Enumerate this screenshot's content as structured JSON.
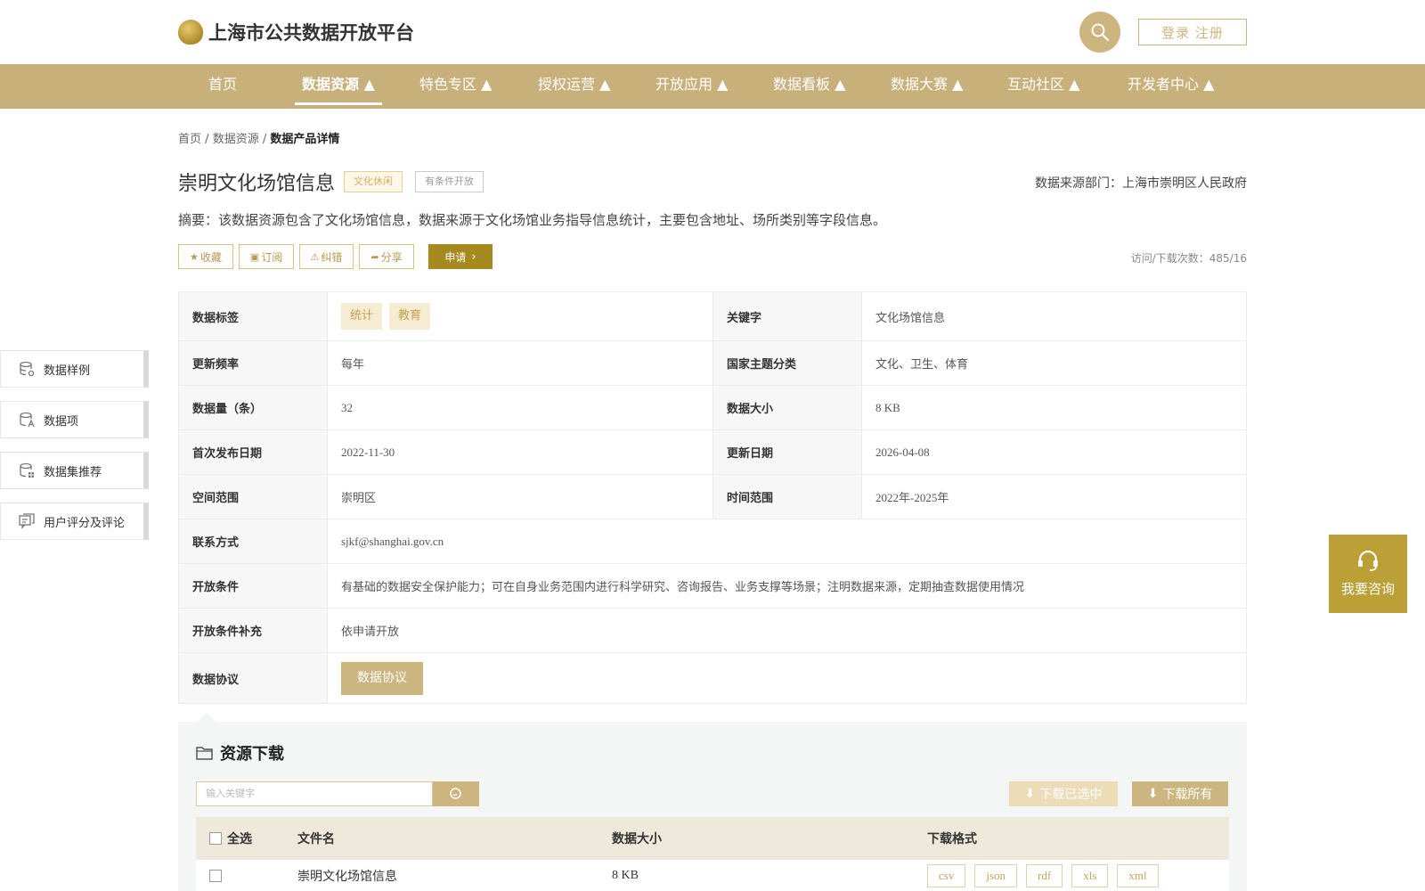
{
  "header": {
    "logo_text": "上海市公共数据开放平台",
    "login_label": "登录 注册",
    "nav": [
      {
        "label": "首页"
      },
      {
        "label": "数据资源 ▲"
      },
      {
        "label": "特色专区 ▲"
      },
      {
        "label": "授权运营 ▲"
      },
      {
        "label": "开放应用 ▲"
      },
      {
        "label": "数据看板 ▲"
      },
      {
        "label": "数据大赛 ▲"
      },
      {
        "label": "互动社区 ▲"
      },
      {
        "label": "开发者中心 ▲"
      }
    ],
    "active_nav": "数据资源 ▲"
  },
  "breadcrumb": {
    "home": "首页",
    "sep": "/",
    "level2": "数据资源",
    "current": "数据产品详情"
  },
  "dataset": {
    "title": "崇明文化场馆信息",
    "tag_category": "文化休闲",
    "tag_openness": "有条件开放",
    "source_dept": "数据来源部门：上海市崇明区人民政府",
    "summary": "摘要：该数据资源包含了文化场馆信息，数据来源于文化场馆业务指导信息统计，主要包含地址、场所类别等字段信息。",
    "visits": "访问/下载次数：485/16"
  },
  "actions": {
    "favorite": "收藏",
    "subscribe": "订阅",
    "correct": "纠错",
    "share": "分享",
    "apply": "申请"
  },
  "details": {
    "tags_label": "数据标签",
    "tags": [
      "统计",
      "教育"
    ],
    "keyword_label": "关键字",
    "keyword": "文化场馆信息",
    "freq_label": "更新频率",
    "freq": "每年",
    "theme_label": "国家主题分类",
    "theme": "文化、卫生、体育",
    "count_label": "数据量（条）",
    "count": "32",
    "size_label": "数据大小",
    "size": "8 KB",
    "first_pub_label": "首次发布日期",
    "first_pub": "2022-11-30",
    "update_label": "更新日期",
    "update": "2026-04-08",
    "space_label": "空间范围",
    "space": "崇明区",
    "time_label": "时间范围",
    "time": "2022年-2025年",
    "contact_label": "联系方式",
    "contact": "sjkf@shanghai.gov.cn",
    "cond_label": "开放条件",
    "cond": "有基础的数据安全保护能力；可在自身业务范围内进行科学研究、咨询报告、业务支撑等场景；注明数据来源，定期抽查数据使用情况",
    "cond_extra_label": "开放条件补充",
    "cond_extra": "依申请开放",
    "agreement_label": "数据协议",
    "agreement_button": "数据协议"
  },
  "side_menu": [
    {
      "label": "数据样例"
    },
    {
      "label": "数据项"
    },
    {
      "label": "数据集推荐"
    },
    {
      "label": "用户评分及评论"
    }
  ],
  "consult": {
    "label": "我要咨询"
  },
  "download": {
    "title": "资源下载",
    "search_placeholder": "输入关键字",
    "download_selected": "下载已选中",
    "download_all": "下载所有",
    "columns": {
      "select_all": "全选",
      "filename": "文件名",
      "size": "数据大小",
      "format": "下载格式"
    },
    "rows": [
      {
        "filename": "崇明文化场馆信息",
        "size": "8 KB",
        "formats": [
          "csv",
          "json",
          "rdf",
          "xls",
          "xml"
        ]
      }
    ]
  },
  "colors": {
    "brand": "#c8b07b",
    "apply": "#a68a1f",
    "consult": "#bba037"
  }
}
